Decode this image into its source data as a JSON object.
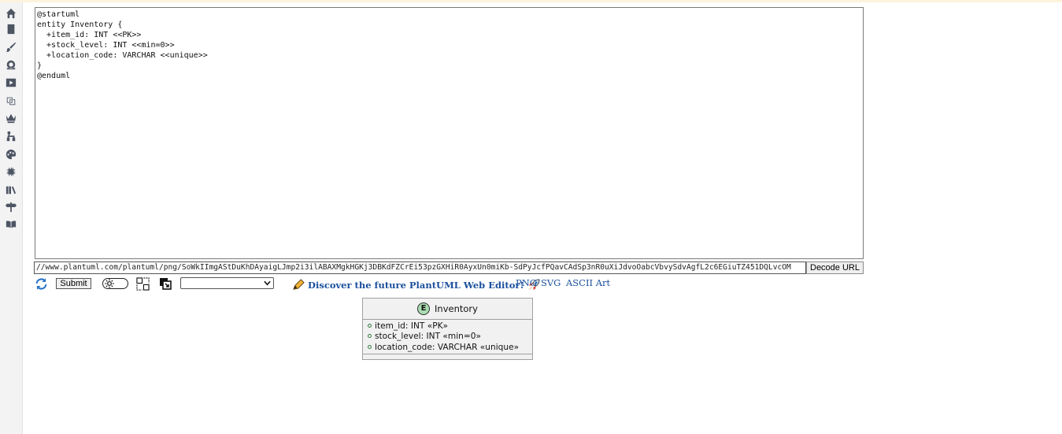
{
  "sidebar": {
    "icons": [
      "home-icon",
      "book-icon",
      "brush-icon",
      "brain-gear-icon",
      "play-icon",
      "copy-icon",
      "crown-icon",
      "sitemap-icon",
      "palette-icon",
      "chip-icon",
      "library-icon",
      "signpost-icon",
      "open-book-icon"
    ]
  },
  "editor": {
    "code": "@startuml\nentity Inventory {\n  +item_id: INT <<PK>>\n  +stock_level: INT <<min=0>>\n  +location_code: VARCHAR <<unique>>\n}\n@enduml"
  },
  "url_bar": {
    "value": "//www.plantuml.com/plantuml/png/SoWkIImgAStDuKhDAyaigLJmp2i3ilABAXMgkHGKj3DBKdFZCrEi53pzGXHiR0AyxUn0miKb-SdPyJcfPQavCAdSp3nR0uXiJdvoOabcVbvySdvAgfL2c6EGiuTZ451DQLvcOM",
    "decode_label": "Decode URL"
  },
  "toolbar": {
    "submit_label": "Submit",
    "select_value": "",
    "promo_text": "Discover the future PlantUML Web Editor!",
    "formats": [
      "PNG",
      "SVG",
      "ASCII Art"
    ]
  },
  "diagram": {
    "badge": "E",
    "entity_name": "Inventory",
    "fields": [
      "item_id: INT «PK»",
      "stock_level: INT «min=0»",
      "location_code: VARCHAR «unique»"
    ],
    "colors": {
      "badge": "#a9dcb1",
      "box": "#f1f1f1",
      "border": "#a0a0a0",
      "field_marker": "#2f7a3c"
    }
  },
  "colors": {
    "link": "#1a4f9c",
    "sidebar_icon": "#4d5563"
  }
}
